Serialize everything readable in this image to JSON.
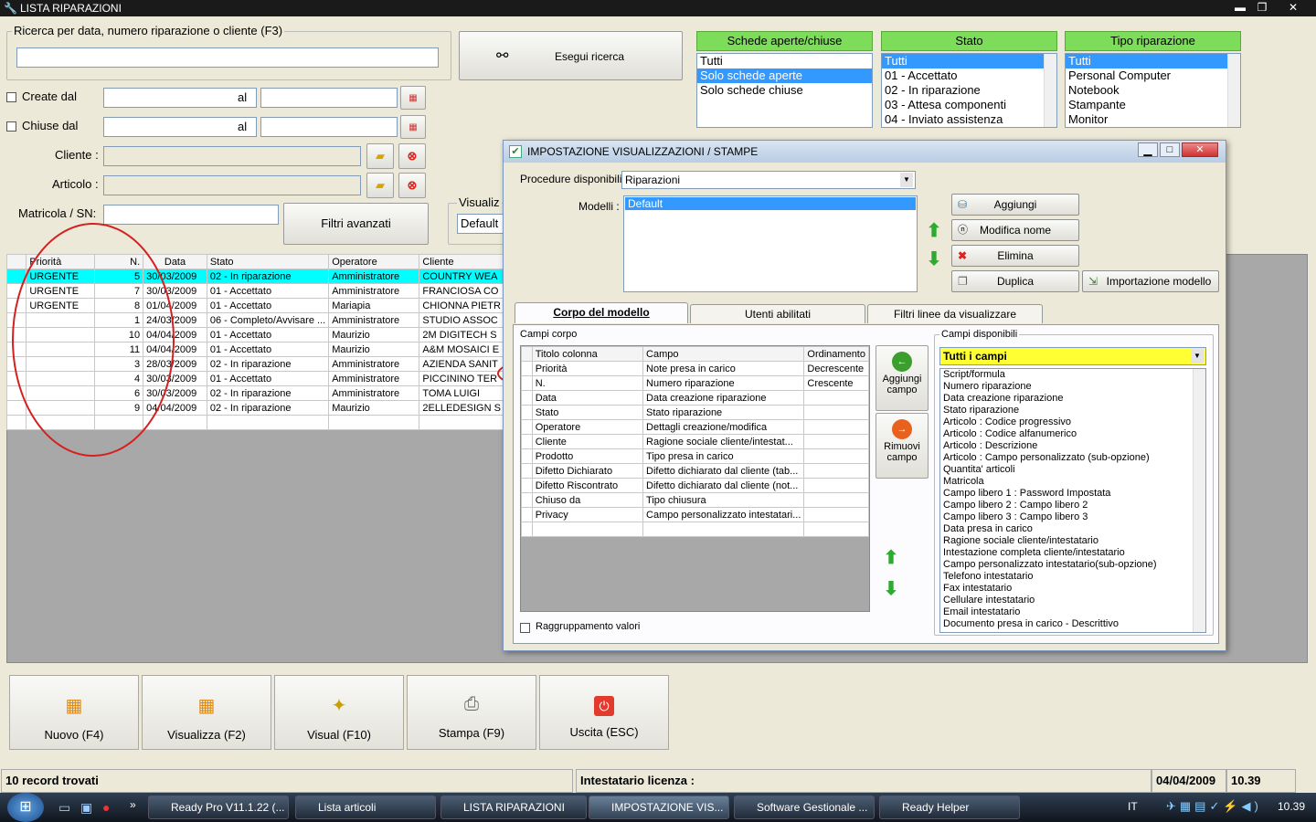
{
  "window": {
    "title": "LISTA RIPARAZIONI",
    "min": "▬",
    "max": "❐",
    "close": "✕"
  },
  "search": {
    "legend": "Ricerca per data, numero riparazione o cliente (F3)",
    "value": "",
    "button_label": "Esegui ricerca"
  },
  "filters": {
    "created_label": "Create dal",
    "closed_label": "Chiuse dal",
    "al_label": "al",
    "cliente_label": "Cliente :",
    "articolo_label": "Articolo :",
    "matricola_label": "Matricola / SN:",
    "advanced_label": "Filtri avanzati",
    "visualizza_legend": "Visualiz",
    "visualizza_value": "Default"
  },
  "schede": {
    "header": "Schede aperte/chiuse",
    "items": [
      "Tutti",
      "Solo schede aperte",
      "Solo schede chiuse"
    ],
    "selected": 1
  },
  "stato": {
    "header": "Stato",
    "items": [
      "Tutti",
      "01 - Accettato",
      "02 - In riparazione",
      "03 - Attesa componenti",
      "04 - Inviato assistenza"
    ],
    "selected": 0
  },
  "tipo": {
    "header": "Tipo riparazione",
    "items": [
      "Tutti",
      "Personal Computer",
      "Notebook",
      "Stampante",
      "Monitor"
    ],
    "selected": 0
  },
  "table": {
    "columns": [
      "Priorità",
      "N.",
      "Data",
      "Stato",
      "Operatore",
      "Cliente"
    ],
    "rows": [
      [
        "URGENTE",
        "5",
        "30/03/2009",
        "02 - In riparazione",
        "Amministratore",
        "COUNTRY WEA"
      ],
      [
        "URGENTE",
        "7",
        "30/03/2009",
        "01 - Accettato",
        "Amministratore",
        "FRANCIOSA CO"
      ],
      [
        "URGENTE",
        "8",
        "01/04/2009",
        "01 - Accettato",
        "Mariapia",
        "CHIONNA PIETR"
      ],
      [
        "",
        "1",
        "24/03/2009",
        "06 - Completo/Avvisare ...",
        "Amministratore",
        "STUDIO ASSOC"
      ],
      [
        "",
        "10",
        "04/04/2009",
        "01 - Accettato",
        "Maurizio",
        "2M DIGITECH S"
      ],
      [
        "",
        "11",
        "04/04/2009",
        "01 - Accettato",
        "Maurizio",
        "A&M MOSAICI E"
      ],
      [
        "",
        "3",
        "28/03/2009",
        "02 - In riparazione",
        "Amministratore",
        "AZIENDA SANIT"
      ],
      [
        "",
        "4",
        "30/03/2009",
        "01 - Accettato",
        "Amministratore",
        "PICCININO TER"
      ],
      [
        "",
        "6",
        "30/03/2009",
        "02 - In riparazione",
        "Amministratore",
        "TOMA LUIGI"
      ],
      [
        "",
        "9",
        "04/04/2009",
        "02 - In riparazione",
        "Maurizio",
        "2ELLEDESIGN S"
      ]
    ]
  },
  "bottom_buttons": [
    {
      "label": "Nuovo (F4)",
      "icon": "new-grid-icon"
    },
    {
      "label": "Visualizza (F2)",
      "icon": "view-grid-icon"
    },
    {
      "label": "Visual (F10)",
      "icon": "magic-wand-icon"
    },
    {
      "label": "Stampa (F9)",
      "icon": "printer-icon"
    },
    {
      "label": "Uscita (ESC)",
      "icon": "power-icon"
    }
  ],
  "statusbar": {
    "records": "10 record trovati",
    "license": "Intestatario licenza :",
    "date": "04/04/2009",
    "time": "10.39"
  },
  "dialog": {
    "title": "IMPOSTAZIONE VISUALIZZAZIONI / STAMPE",
    "procedure_label": "Procedure disponibili :",
    "procedure_value": "Riparazioni",
    "modelli_label": "Modelli :",
    "modelli": [
      "Default"
    ],
    "buttons": {
      "aggiungi": "Aggiungi",
      "modifica": "Modifica nome",
      "elimina": "Elimina",
      "duplica": "Duplica",
      "importazione": "Importazione modello"
    },
    "tabs": [
      "Corpo del modello",
      "Utenti abilitati",
      "Filtri linee da visualizzare"
    ],
    "campi_corpo_label": "Campi corpo",
    "corpo_columns": [
      "Titolo colonna",
      "Campo",
      "Ordinamento"
    ],
    "corpo_rows": [
      [
        "Priorità",
        "Note presa in carico",
        "Decrescente"
      ],
      [
        "N.",
        "Numero riparazione",
        "Crescente"
      ],
      [
        "Data",
        "Data creazione riparazione",
        ""
      ],
      [
        "Stato",
        "Stato riparazione",
        ""
      ],
      [
        "Operatore",
        "Dettagli creazione/modifica",
        ""
      ],
      [
        "Cliente",
        "Ragione sociale cliente/intestat...",
        ""
      ],
      [
        "Prodotto",
        "Tipo presa in carico",
        ""
      ],
      [
        "Difetto Dichiarato",
        "Difetto dichiarato dal cliente (tab...",
        ""
      ],
      [
        "Difetto Riscontrato",
        "Difetto dichiarato dal cliente (not...",
        ""
      ],
      [
        "Chiuso da",
        "Tipo chiusura",
        ""
      ],
      [
        "Privacy",
        "Campo personalizzato intestatari...",
        ""
      ],
      [
        "",
        "",
        ""
      ]
    ],
    "aggiungi_campo": "Aggiungi campo",
    "rimuovi_campo": "Rimuovi campo",
    "raggruppamento_label": "Raggruppamento valori",
    "campi_disponibili_label": "Campi disponibili",
    "campi_filter": "Tutti i campi",
    "campi_disponibili": [
      "Script/formula",
      "Numero riparazione",
      "Data creazione riparazione",
      "Stato riparazione",
      "Articolo : Codice progressivo",
      "Articolo : Codice alfanumerico",
      "Articolo : Descrizione",
      "Articolo : Campo personalizzato (sub-opzione)",
      "Quantita' articoli",
      "Matricola",
      "Campo libero 1 : Password Impostata",
      "Campo libero 2 : Campo libero 2",
      "Campo libero 3 : Campo libero 3",
      "Data presa in carico",
      "Ragione sociale cliente/intestatario",
      "Intestazione completa cliente/intestatario",
      "Campo personalizzato intestatario(sub-opzione)",
      "Telefono intestatario",
      "Fax intestatario",
      "Cellulare intestatario",
      "Email intestatario",
      "Documento presa in carico - Descrittivo"
    ]
  },
  "taskbar": {
    "items": [
      "Ready Pro V11.1.22 (...",
      "Lista articoli",
      "LISTA RIPARAZIONI",
      "IMPOSTAZIONE VIS...",
      "Software Gestionale ...",
      "Ready Helper"
    ],
    "lang": "IT",
    "clock": "10.39"
  },
  "colors": {
    "highlight_row": "#00ffff",
    "green_header": "#7ddc5a",
    "selection": "#3399ff",
    "annotation": "#d42020",
    "filter_yellow": "#ffff33"
  }
}
